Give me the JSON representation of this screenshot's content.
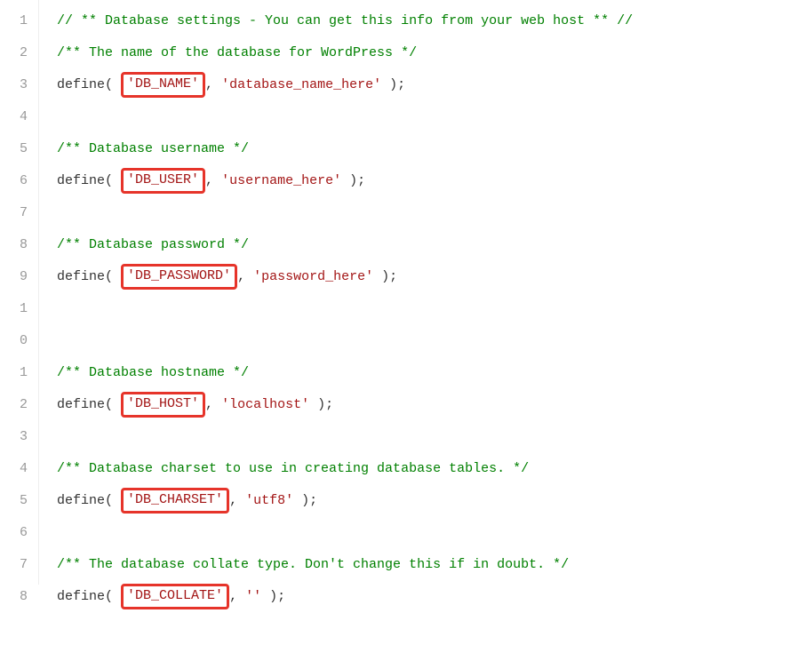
{
  "gutter": [
    "1",
    "2",
    "3",
    "4",
    "5",
    "6",
    "7",
    "8",
    "9",
    "1",
    "0",
    "1",
    "2",
    "3",
    "4",
    "5",
    "6",
    "7",
    "8"
  ],
  "c": {
    "header": "// ** Database settings - You can get this info from your web host ** //",
    "name_c": "/** The name of the database for WordPress */",
    "user_c": "/** Database username */",
    "pass_c": "/** Database password */",
    "host_c": "/** Database hostname */",
    "charset_c": "/** Database charset to use in creating database tables. */",
    "collate_c": "/** The database collate type. Don't change this if in doubt. */"
  },
  "code": {
    "define": "define",
    "lp": "( ",
    "comma": ", ",
    "rp": " );",
    "db_name_k": "'DB_NAME'",
    "db_name_v": "'database_name_here'",
    "db_user_k": "'DB_USER'",
    "db_user_v": "'username_here'",
    "db_pass_k": "'DB_PASSWORD'",
    "db_pass_v": "'password_here'",
    "db_host_k": "'DB_HOST'",
    "db_host_v": "'localhost'",
    "db_charset_k": "'DB_CHARSET'",
    "db_charset_v": "'utf8'",
    "db_collate_k": "'DB_COLLATE'",
    "db_collate_v": "''"
  }
}
